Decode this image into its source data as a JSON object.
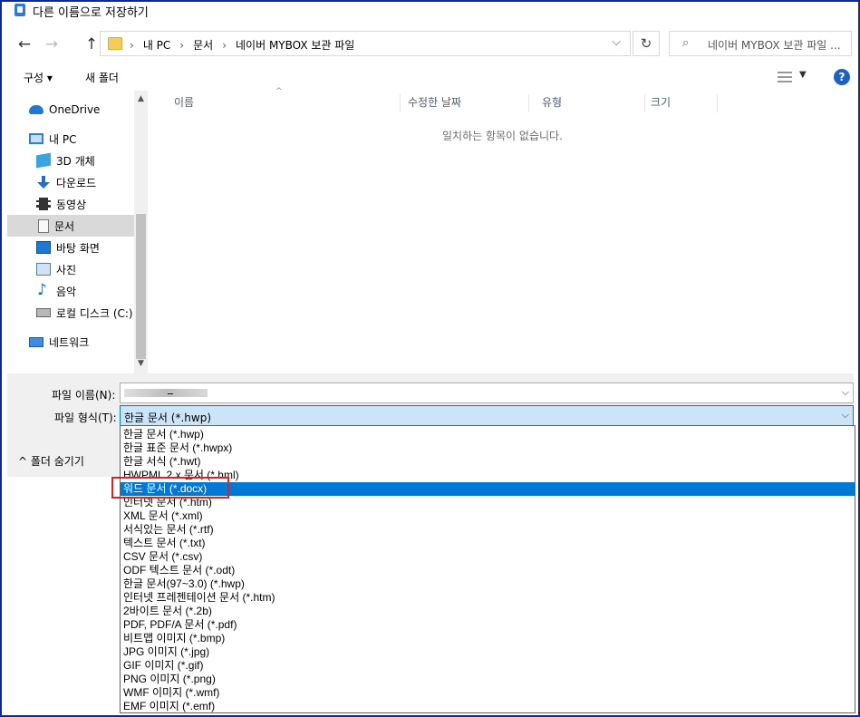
{
  "window": {
    "title": "다른 이름으로 저장하기"
  },
  "nav_buttons": {
    "back": "←",
    "forward": "→",
    "up": "↑"
  },
  "address": {
    "crumbs": [
      "내 PC",
      "문서",
      "네이버 MYBOX 보관 파일"
    ],
    "separator": "›",
    "dropdown": "⌵",
    "refresh": "↻"
  },
  "search": {
    "icon": "⌕",
    "placeholder": "네이버 MYBOX 보관 파일 ..."
  },
  "toolbar": {
    "organize": "구성 ▾",
    "new_folder": "새 폴더",
    "view_dropdown": "▼",
    "help": "?"
  },
  "sidebar": {
    "items": [
      {
        "label": "OneDrive",
        "icon": "cloud-icon"
      },
      {
        "label": "내 PC",
        "icon": "pc-icon"
      },
      {
        "label": "3D 개체",
        "icon": "cube-icon"
      },
      {
        "label": "다운로드",
        "icon": "download-icon"
      },
      {
        "label": "동영상",
        "icon": "video-icon"
      },
      {
        "label": "문서",
        "icon": "document-icon",
        "selected": true
      },
      {
        "label": "바탕 화면",
        "icon": "desktop-icon"
      },
      {
        "label": "사진",
        "icon": "pictures-icon"
      },
      {
        "label": "음악",
        "icon": "music-icon"
      },
      {
        "label": "로컬 디스크 (C:)",
        "icon": "drive-icon"
      },
      {
        "label": "네트워크",
        "icon": "network-icon"
      }
    ],
    "scroll_up": "▲",
    "scroll_down": "▼"
  },
  "file_list": {
    "columns": [
      "이름",
      "수정한 날짜",
      "유형",
      "크기"
    ],
    "sort_indicator": "^",
    "empty_message": "일치하는 항목이 없습니다."
  },
  "form": {
    "filename_label": "파일 이름(N):",
    "filename_marker": "_",
    "filetype_label": "파일 형식(T):",
    "filetype_value": "한글 문서 (*.hwp)",
    "dropdown_arrow": "⌵",
    "hide_folders": "^  폴더 숨기기"
  },
  "filetype_options": [
    "한글 문서 (*.hwp)",
    "한글 표준 문서 (*.hwpx)",
    "한글 서식 (*.hwt)",
    "HWPML 2.x 문서 (*.hml)",
    "워드 문서 (*.docx)",
    "인터넷 문서 (*.htm)",
    "XML 문서 (*.xml)",
    "서식있는 문서 (*.rtf)",
    "텍스트 문서 (*.txt)",
    "CSV 문서 (*.csv)",
    "ODF 텍스트 문서 (*.odt)",
    "한글 문서(97~3.0) (*.hwp)",
    "인터넷 프레젠테이션 문서 (*.htm)",
    "2바이트 문서 (*.2b)",
    "PDF, PDF/A 문서 (*.pdf)",
    "비트맵 이미지 (*.bmp)",
    "JPG 이미지 (*.jpg)",
    "GIF 이미지 (*.gif)",
    "PNG 이미지 (*.png)",
    "WMF 이미지 (*.wmf)",
    "EMF 이미지 (*.emf)"
  ],
  "selected_option_index": 4,
  "colors": {
    "selection": "#0078d7",
    "highlight_box": "#e02020",
    "frame": "#0a2a9c"
  }
}
